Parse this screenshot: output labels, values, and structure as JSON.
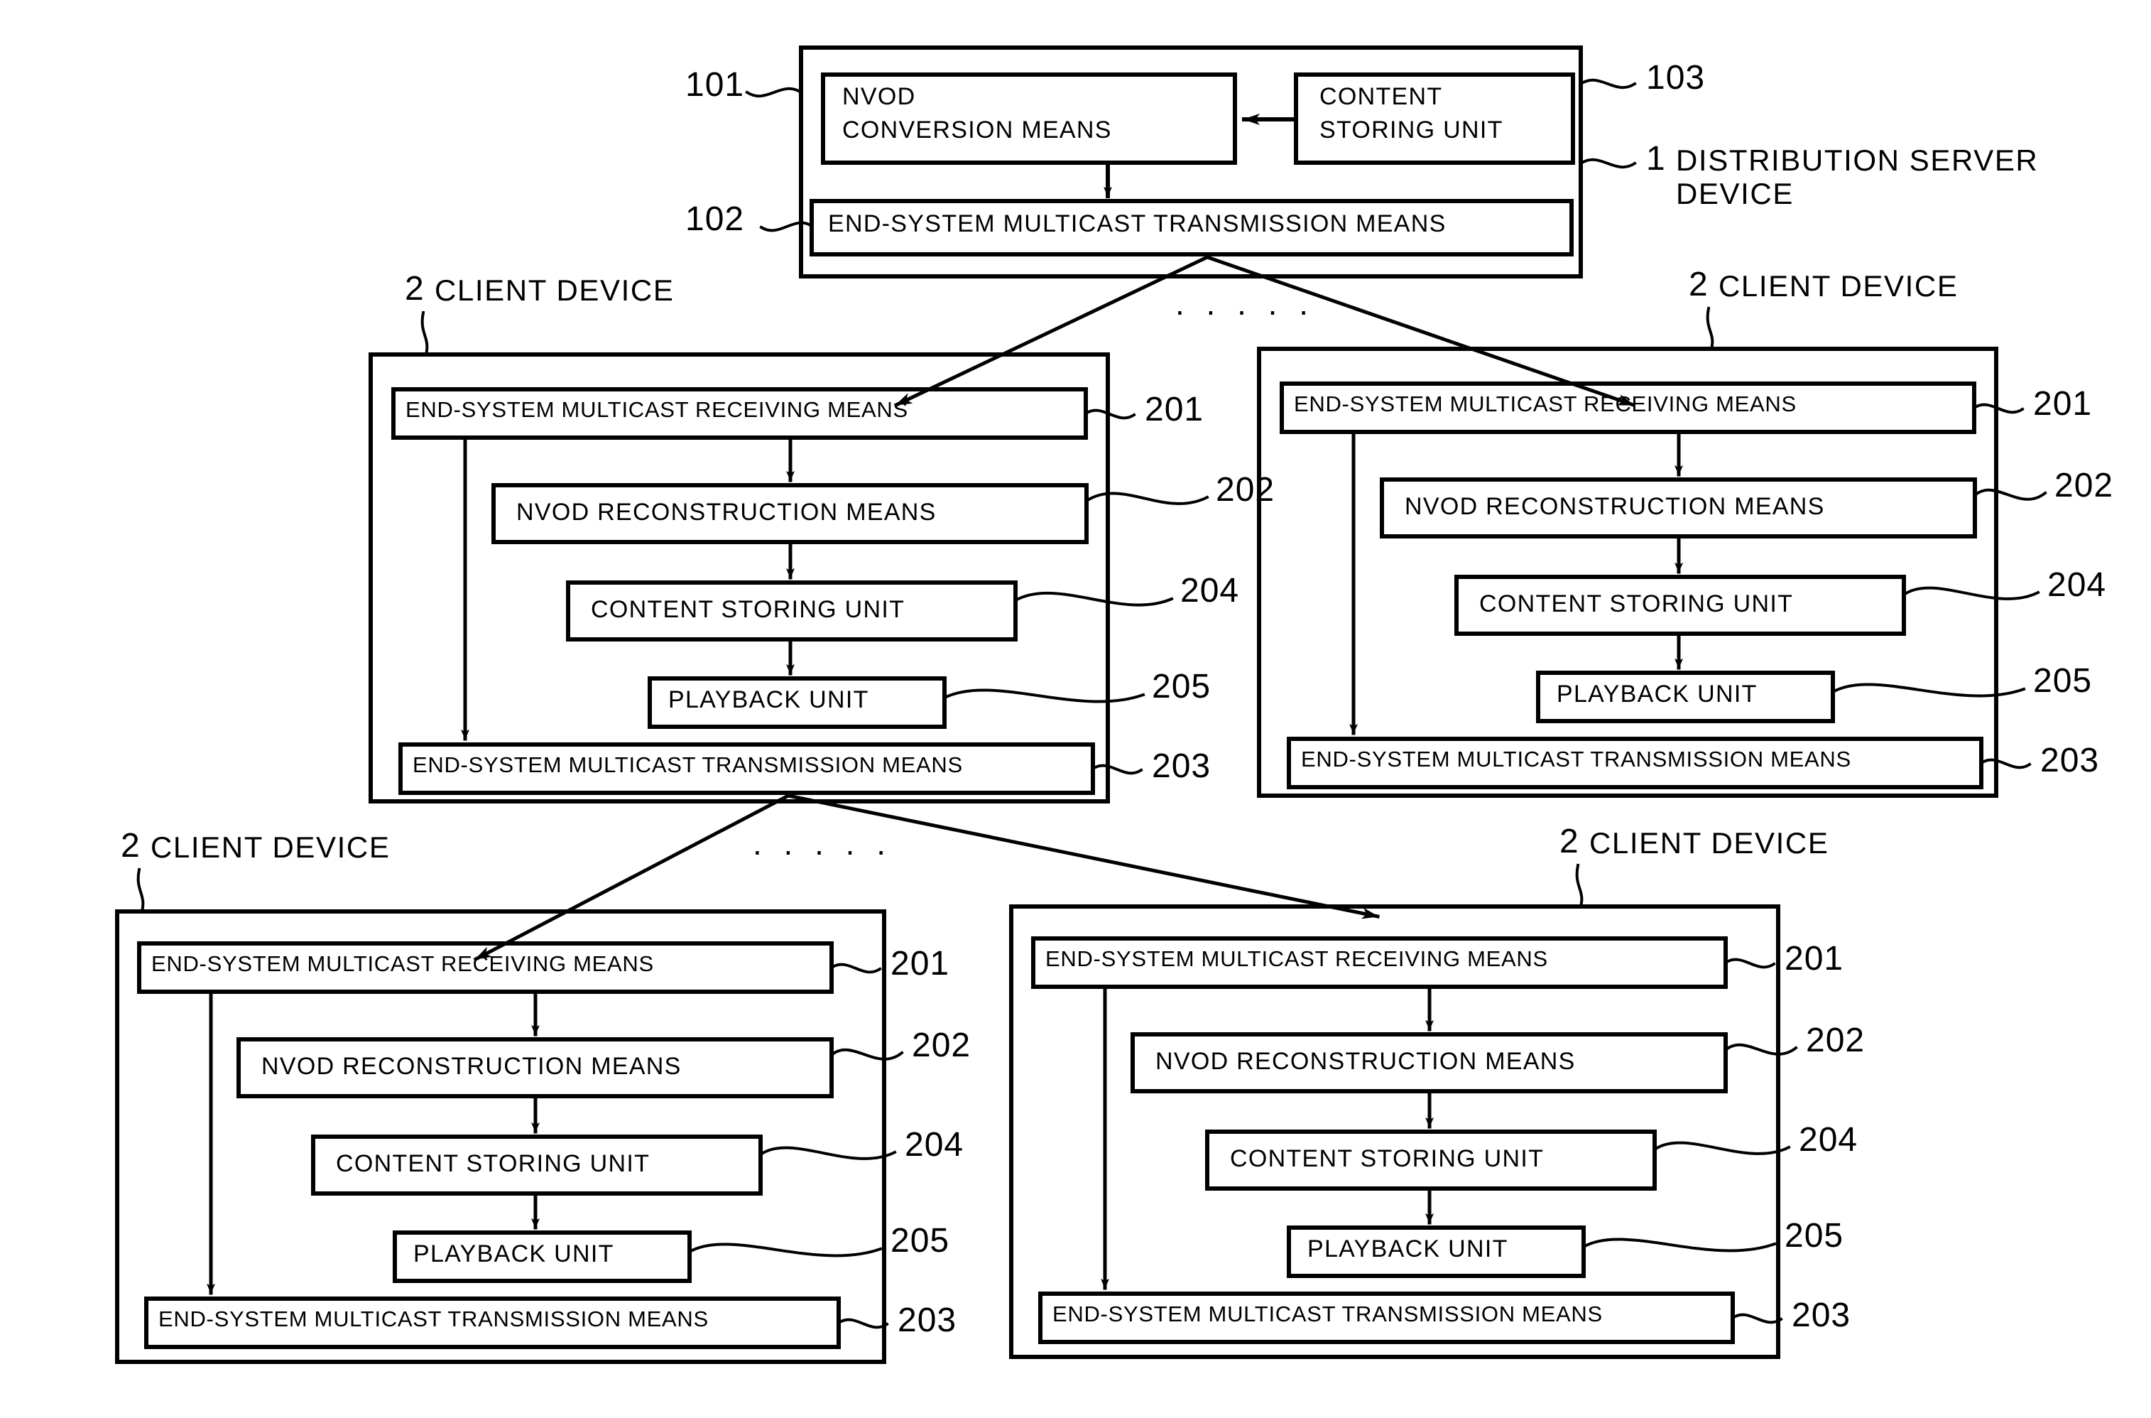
{
  "figure": {
    "kind": "patent-block-diagram",
    "background": "#ffffff",
    "stroke": "#000000"
  },
  "server": {
    "ref": "1",
    "label_line1": "DISTRIBUTION  SERVER",
    "label_line2": "DEVICE",
    "blocks": {
      "nvod_conversion": {
        "ref": "101",
        "line1": "NVOD",
        "line2": "CONVERSION  MEANS"
      },
      "content_storing": {
        "ref": "103",
        "line1": "CONTENT",
        "line2": "STORING  UNIT"
      },
      "transmission": {
        "ref": "102",
        "label": "END-SYSTEM  MULTICAST  TRANSMISSION  MEANS"
      }
    }
  },
  "client_label": {
    "ref": "2",
    "text": "CLIENT  DEVICE"
  },
  "client_blocks": {
    "receiving": {
      "ref": "201",
      "label": "END-SYSTEM  MULTICAST  RECEIVING  MEANS"
    },
    "reconstruction": {
      "ref": "202",
      "label": "NVOD  RECONSTRUCTION  MEANS"
    },
    "content_storing": {
      "ref": "204",
      "label": "CONTENT STORING  UNIT"
    },
    "playback": {
      "ref": "205",
      "label": "PLAYBACK  UNIT"
    },
    "transmission": {
      "ref": "203",
      "label": "END-SYSTEM  MULTICAST  TRANSMISSION  MEANS"
    }
  },
  "clients": [
    {
      "id": "client-top-left"
    },
    {
      "id": "client-top-right"
    },
    {
      "id": "client-bottom-left"
    },
    {
      "id": "client-bottom-right"
    }
  ],
  "ellipsis": {
    "top": ". . . . .",
    "bottom": ". . . . ."
  }
}
